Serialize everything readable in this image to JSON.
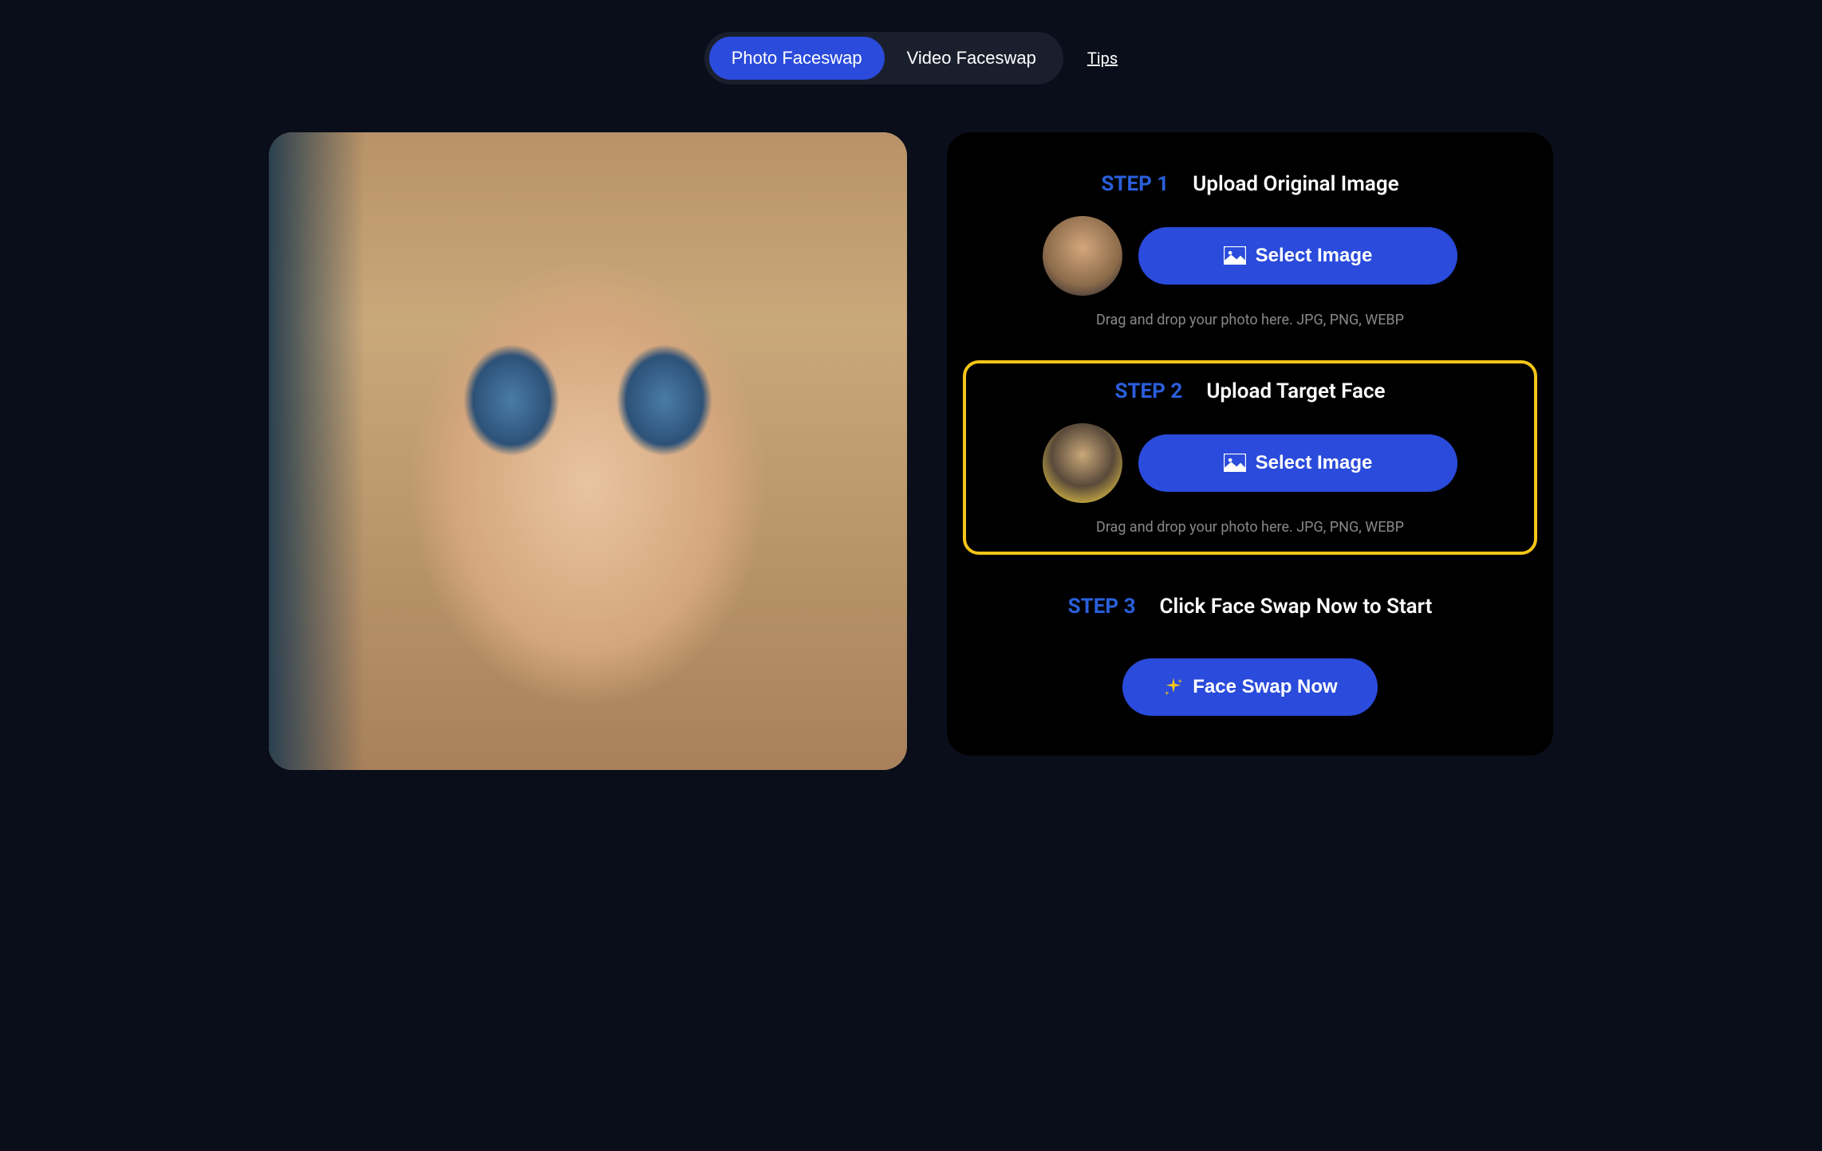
{
  "nav": {
    "tabs": [
      {
        "label": "Photo Faceswap",
        "active": true
      },
      {
        "label": "Video Faceswap",
        "active": false
      }
    ],
    "tips_label": "Tips"
  },
  "steps": {
    "step1": {
      "label": "STEP 1",
      "title": "Upload Original Image",
      "button": "Select Image",
      "hint": "Drag and drop your photo here. JPG, PNG, WEBP"
    },
    "step2": {
      "label": "STEP 2",
      "title": "Upload Target Face",
      "button": "Select Image",
      "hint": "Drag and drop your photo here. JPG, PNG, WEBP",
      "highlighted": true
    },
    "step3": {
      "label": "STEP 3",
      "title": "Click Face Swap Now to Start",
      "button": "Face Swap Now"
    }
  },
  "colors": {
    "accent": "#2a4bdb",
    "highlight": "#f5c518",
    "background": "#0a0e1a",
    "panel": "#000000"
  }
}
